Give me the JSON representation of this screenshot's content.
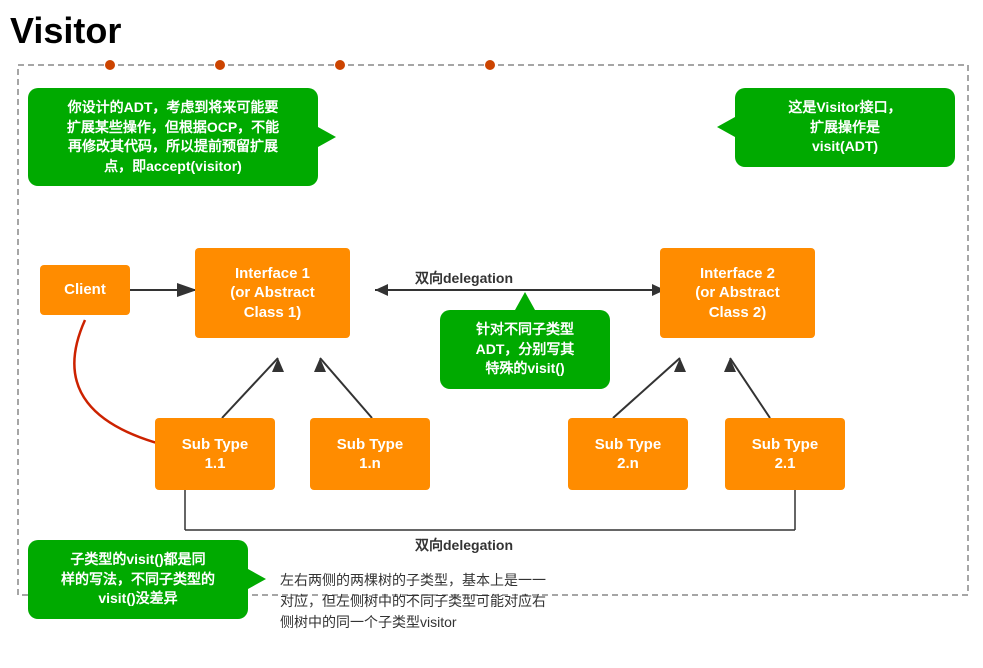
{
  "title": "Visitor",
  "boxes": {
    "client": {
      "label": "Client"
    },
    "interface1": {
      "label": "Interface 1\n(or Abstract\nClass 1)"
    },
    "interface2": {
      "label": "Interface 2\n(or Abstract\nClass 2)"
    },
    "subtype11": {
      "label": "Sub Type\n1.1"
    },
    "subtype1n": {
      "label": "Sub Type\n1.n"
    },
    "subtype2n": {
      "label": "Sub Type\n2.n"
    },
    "subtype21": {
      "label": "Sub Type\n2.1"
    }
  },
  "bubbles": {
    "left_top": {
      "text": "你设计的ADT，考虑到将来可能要\n扩展某些操作，但根据OCP，不能\n再修改其代码，所以提前预留扩展\n点，即accept(visitor)"
    },
    "right_top": {
      "text": "这是Visitor接口，\n扩展操作是\nvisit(ADT)"
    },
    "middle": {
      "text": "针对不同子类型\nADT，分别写其\n特殊的visit()"
    },
    "bottom_left": {
      "text": "子类型的visit()都是同\n样的写法，不同子类型的\nvisit()没差异"
    }
  },
  "labels": {
    "delegation_top": "双向delegation",
    "delegation_bottom": "双向delegation",
    "bottom_text": "左右两侧的两棵树的子类型，基本上是一一\n对应，但左侧树中的不同子类型可能对应右\n侧树中的同一个子类型visitor"
  }
}
